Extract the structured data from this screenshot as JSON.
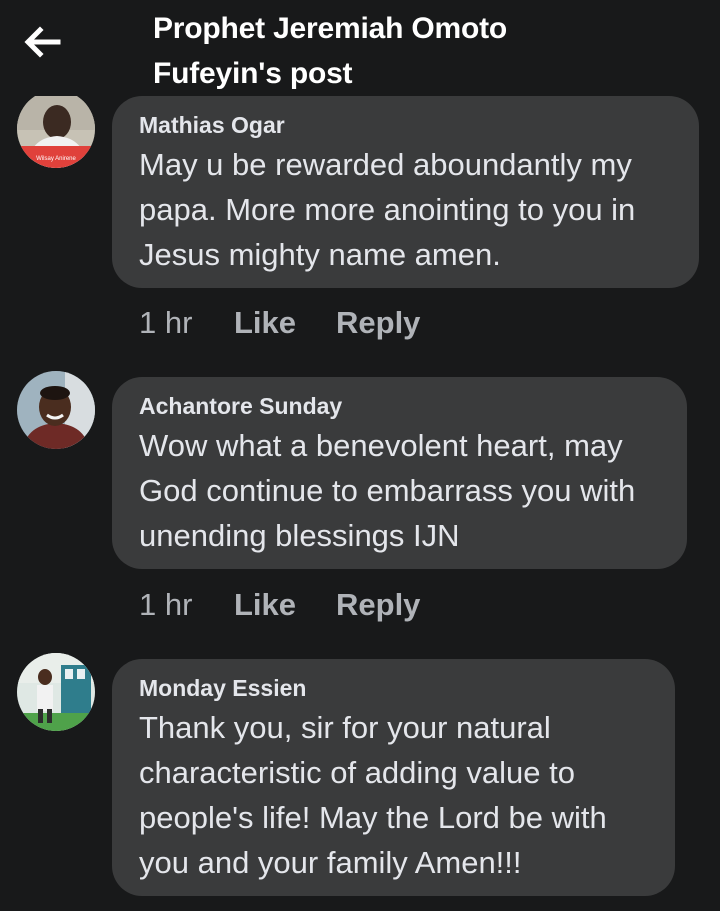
{
  "header": {
    "title": "Prophet Jeremiah Omoto Fufeyin's post",
    "back_icon": "arrow-left-icon"
  },
  "colors": {
    "background": "#18191a",
    "bubble": "#3a3b3c",
    "primary_text": "#e4e6eb",
    "secondary_text": "#b0b3b8"
  },
  "comments": [
    {
      "author": "Mathias Ogar",
      "text": "May u be rewarded aboundantly my papa. More more anointing to you in Jesus mighty name amen.",
      "time": "1 hr",
      "like_label": "Like",
      "reply_label": "Reply",
      "avatar_text": "Wilsay Anirene"
    },
    {
      "author": "Achantore Sunday",
      "text": "Wow what a benevolent heart, may God continue to embarrass you with unending blessings IJN",
      "time": "1 hr",
      "like_label": "Like",
      "reply_label": "Reply"
    },
    {
      "author": "Monday Essien",
      "text": "Thank you, sir for your natural characteristic of adding value to people's life! May the Lord be with you and your family Amen!!!"
    }
  ]
}
